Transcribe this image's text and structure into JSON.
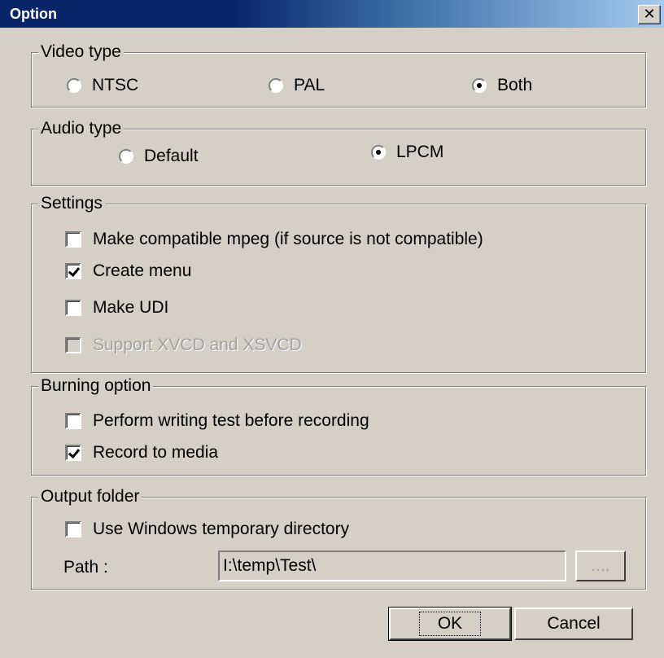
{
  "window": {
    "title": "Option",
    "close_glyph": "✕"
  },
  "video_type": {
    "legend": "Video type",
    "options": [
      {
        "label": "NTSC",
        "selected": false
      },
      {
        "label": "PAL",
        "selected": false
      },
      {
        "label": "Both",
        "selected": true
      }
    ]
  },
  "audio_type": {
    "legend": "Audio type",
    "options": [
      {
        "label": "Default",
        "selected": false
      },
      {
        "label": "LPCM",
        "selected": true
      }
    ]
  },
  "settings": {
    "legend": "Settings",
    "options": [
      {
        "label": "Make compatible mpeg (if source is not compatible)",
        "checked": false,
        "enabled": true
      },
      {
        "label": "Create menu",
        "checked": true,
        "enabled": true
      },
      {
        "label": "Make UDI",
        "checked": false,
        "enabled": true
      },
      {
        "label": "Support XVCD and XSVCD",
        "checked": false,
        "enabled": false
      }
    ]
  },
  "burning_option": {
    "legend": "Burning option",
    "options": [
      {
        "label": "Perform writing test before recording",
        "checked": false
      },
      {
        "label": "Record to media",
        "checked": true
      }
    ]
  },
  "output_folder": {
    "legend": "Output folder",
    "use_temp_dir": {
      "label": "Use Windows temporary directory",
      "checked": false
    },
    "path_label": "Path :",
    "path_value": "I:\\temp\\Test\\",
    "browse_label": "...."
  },
  "buttons": {
    "ok": "OK",
    "cancel": "Cancel"
  }
}
